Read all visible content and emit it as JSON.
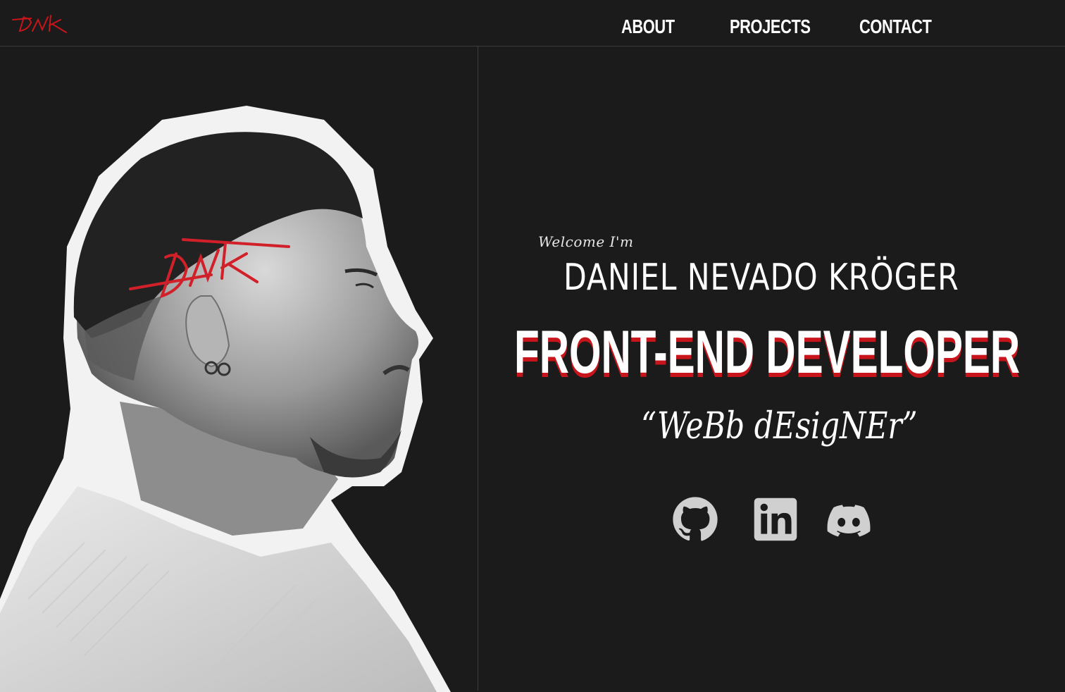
{
  "brand": {
    "logo_icon": "dnk-signature-logo",
    "accent_color": "#c8151b"
  },
  "nav": {
    "items": [
      {
        "label": "ABOUT"
      },
      {
        "label": "PROJECTS"
      },
      {
        "label": "CONTACT"
      }
    ]
  },
  "hero": {
    "welcome": "Welcome I'm",
    "name": "DANIEL NEVADO KRÖGER",
    "role": "FRONT-END DEVELOPER",
    "subtitle": "“WeBb dEsigNEr”",
    "portrait_icon": "profile-portrait-photo"
  },
  "social": [
    {
      "icon": "github-icon",
      "label": "GitHub"
    },
    {
      "icon": "linkedin-icon",
      "label": "LinkedIn"
    },
    {
      "icon": "discord-icon",
      "label": "Discord"
    }
  ],
  "colors": {
    "background": "#1b1b1b",
    "text": "#ffffff",
    "icon": "#d0d0d0",
    "divider": "#3c3c3c"
  }
}
